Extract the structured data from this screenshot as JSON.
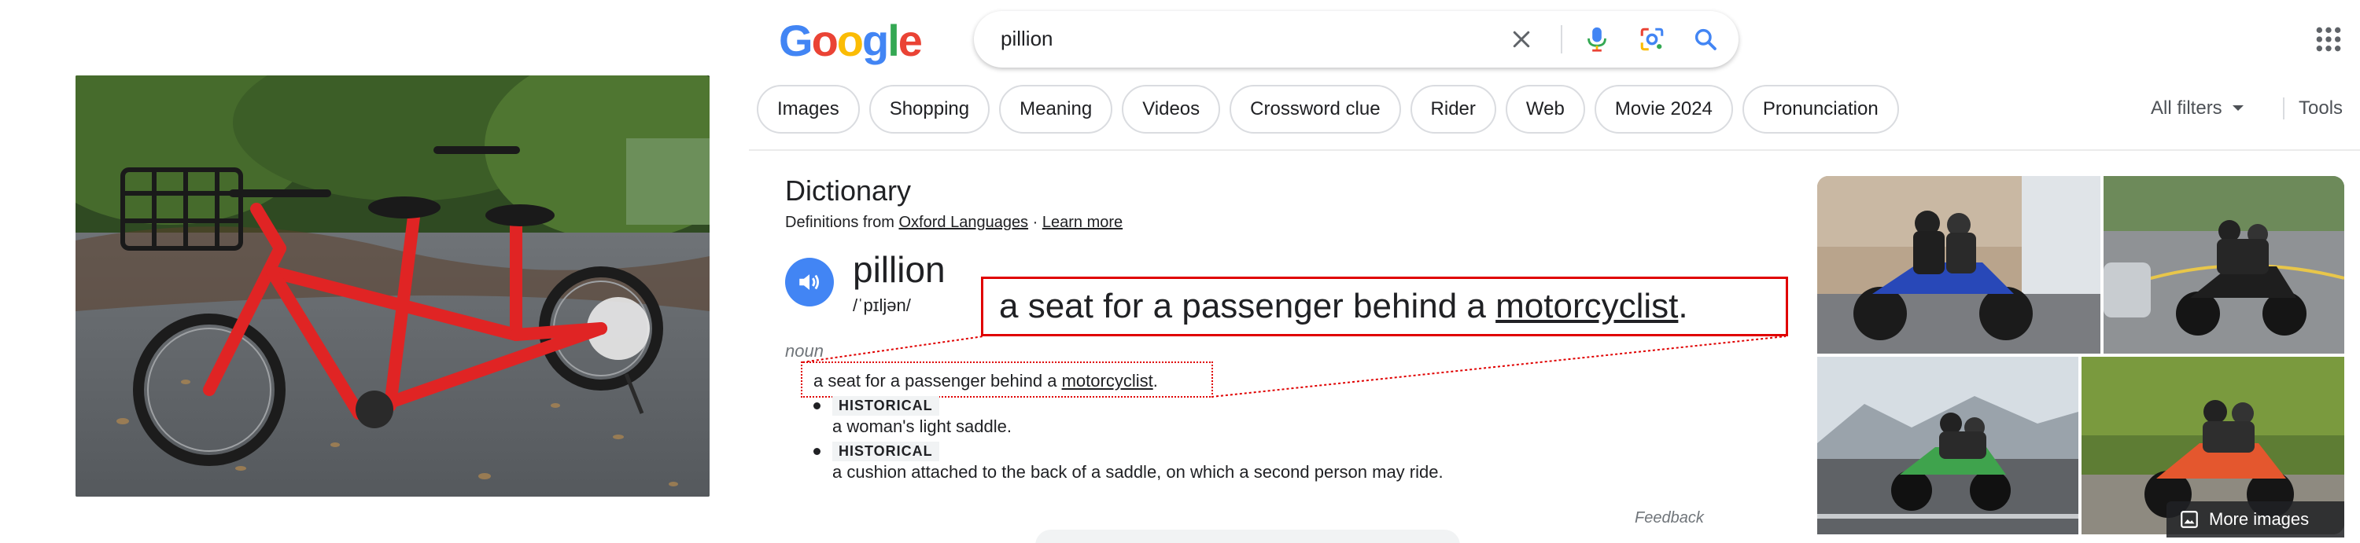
{
  "search": {
    "query": "pillion",
    "logo_text": "Google"
  },
  "chips": [
    "Images",
    "Shopping",
    "Meaning",
    "Videos",
    "Crossword clue",
    "Rider",
    "Web",
    "Movie 2024",
    "Pronunciation"
  ],
  "filters": {
    "all_filters": "All filters",
    "tools": "Tools"
  },
  "dictionary": {
    "title": "Dictionary",
    "source_prefix": "Definitions from",
    "source_link": "Oxford Languages",
    "separator": "·",
    "learn_more": "Learn more",
    "word": "pillion",
    "phonetic": "/ˈpɪljən/",
    "part_of_speech": "noun",
    "definition_text": "a seat for a passenger behind a",
    "definition_link": "motorcyclist",
    "definition_end": ".",
    "senses": [
      {
        "tag": "HISTORICAL",
        "text": "a woman's light saddle."
      },
      {
        "tag": "HISTORICAL",
        "text": "a cushion attached to the back of a saddle, on which a second person may ride."
      }
    ],
    "feedback": "Feedback"
  },
  "zoom_callout": {
    "text": "a seat for a passenger behind a",
    "link": "motorcyclist",
    "end": "."
  },
  "images": {
    "more_label": "More images"
  },
  "colors": {
    "google_blue": "#4285f4",
    "google_red": "#ea4335",
    "google_yellow": "#fbbc05",
    "google_green": "#34a853",
    "callout_red": "#e00000"
  },
  "icons": {
    "clear": "close-icon",
    "voice": "mic-icon",
    "lens": "camera-lens-icon",
    "search": "search-icon",
    "apps": "apps-grid-icon",
    "speaker": "speaker-icon",
    "more_images": "image-icon"
  }
}
